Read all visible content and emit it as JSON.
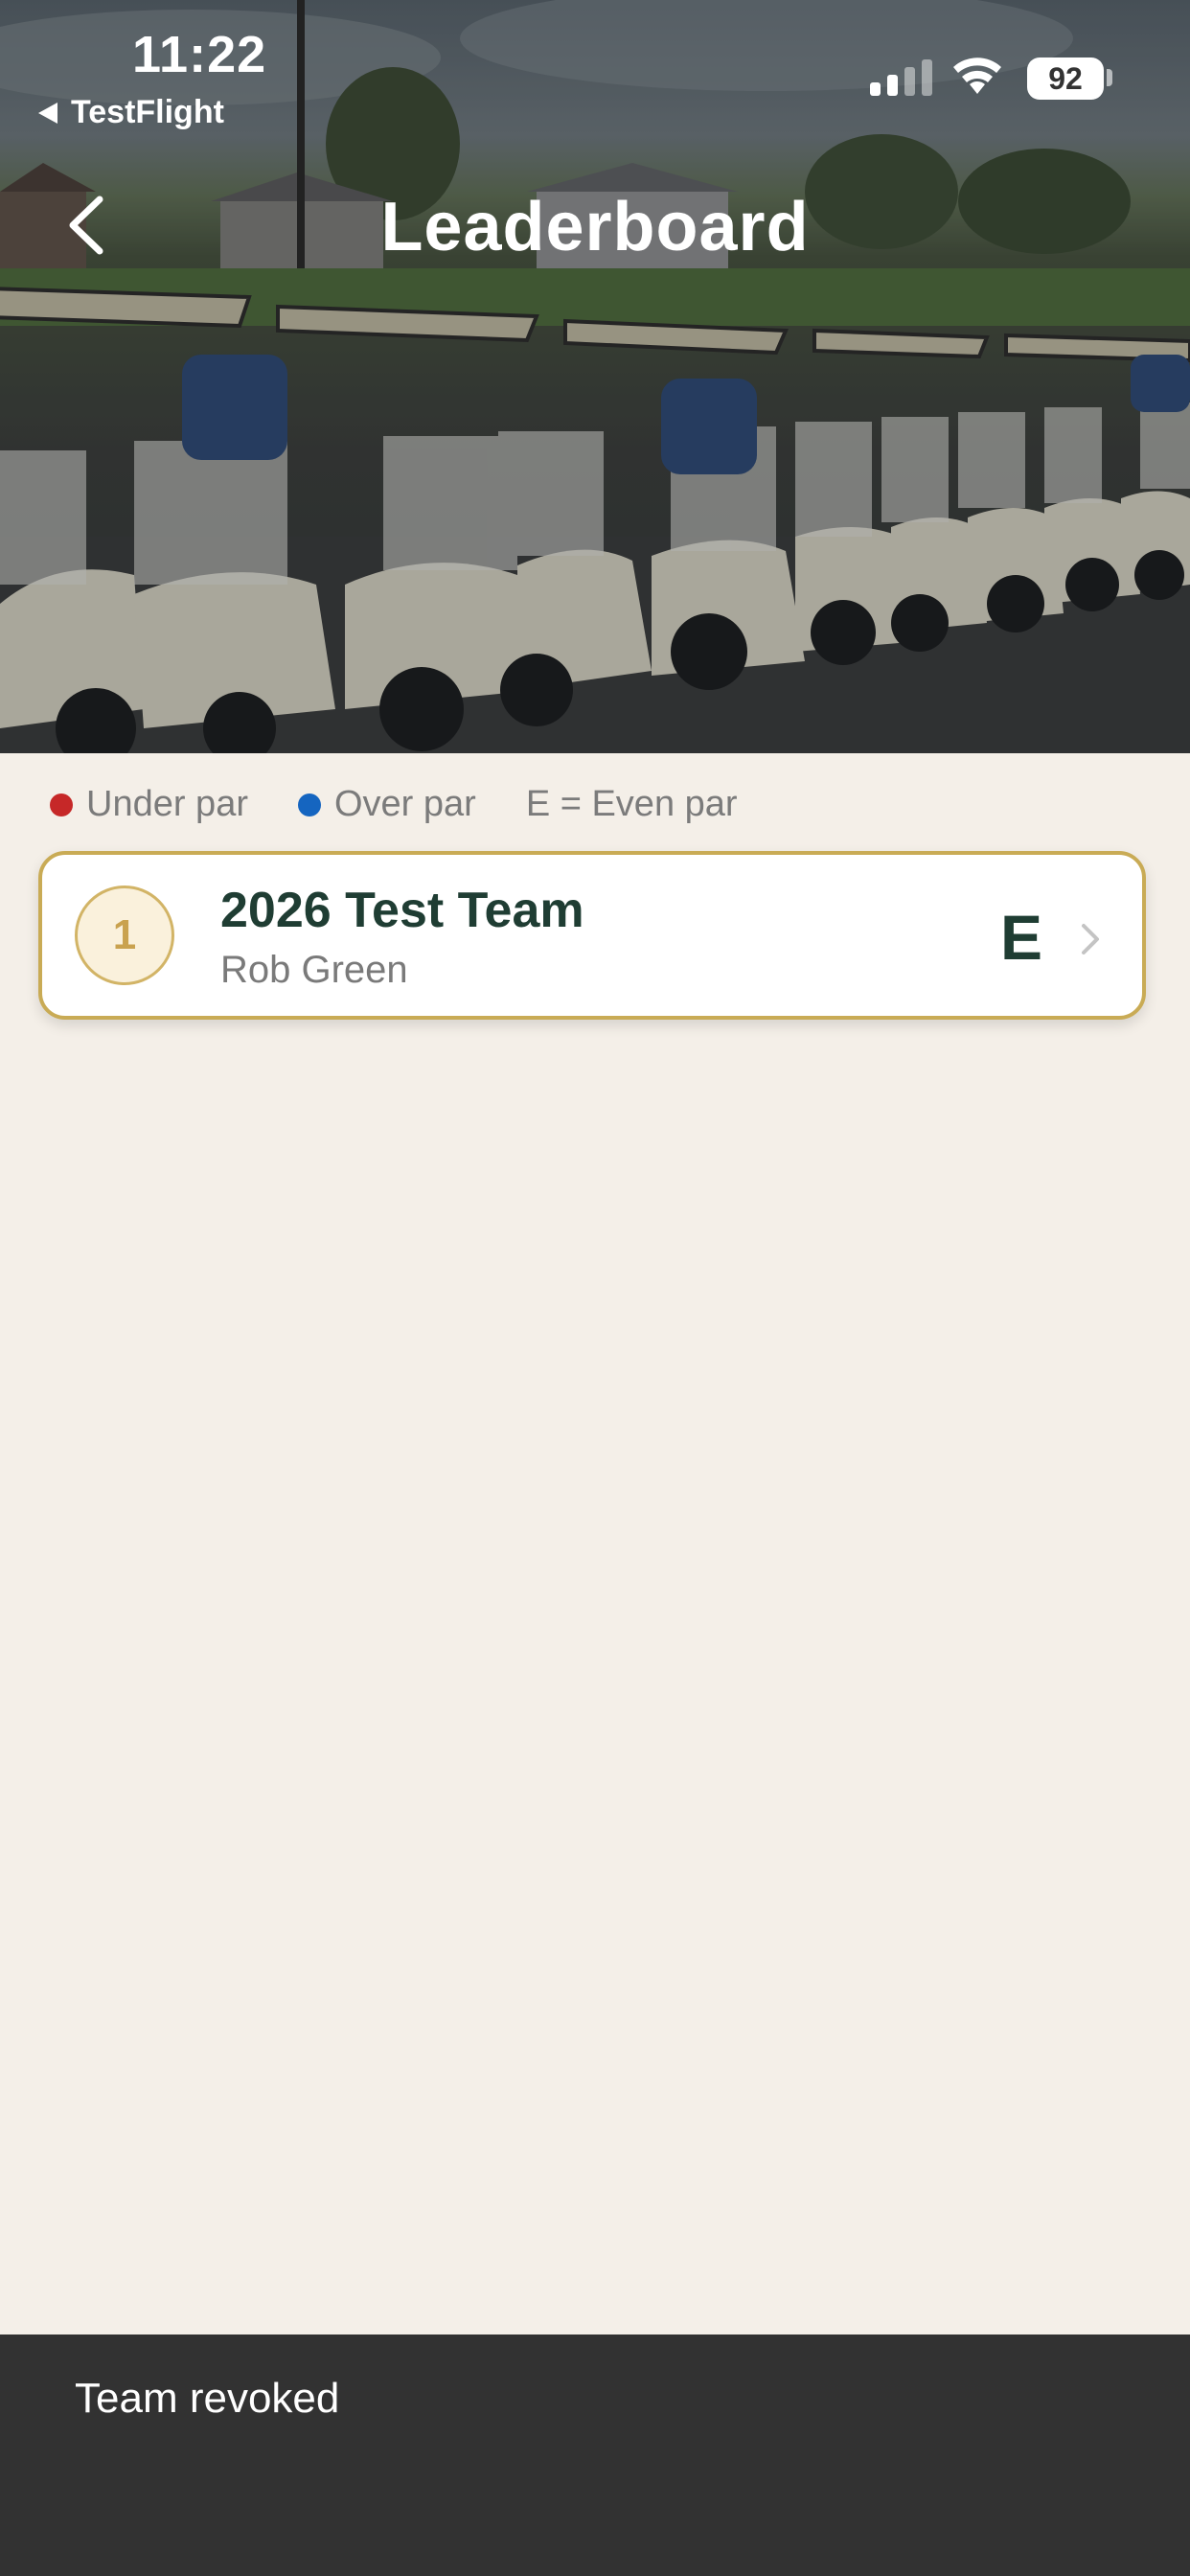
{
  "status_bar": {
    "time": "11:22",
    "back_app": "TestFlight",
    "battery": "92"
  },
  "header": {
    "title": "Leaderboard",
    "background_image": "golf-carts-lined-up"
  },
  "legend": {
    "under_par": "Under par",
    "over_par": "Over par",
    "even_par": "E = Even par",
    "under_par_color": "#c62828",
    "over_par_color": "#1565c0"
  },
  "leaderboard": [
    {
      "rank": "1",
      "team": "2026 Test Team",
      "captain": "Rob Green",
      "score": "E"
    }
  ],
  "snackbar": {
    "message": "Team revoked"
  },
  "colors": {
    "accent_gold": "#c9ab55",
    "team_text": "#1f3d33",
    "background": "#f4efe8",
    "snackbar": "#323232"
  }
}
